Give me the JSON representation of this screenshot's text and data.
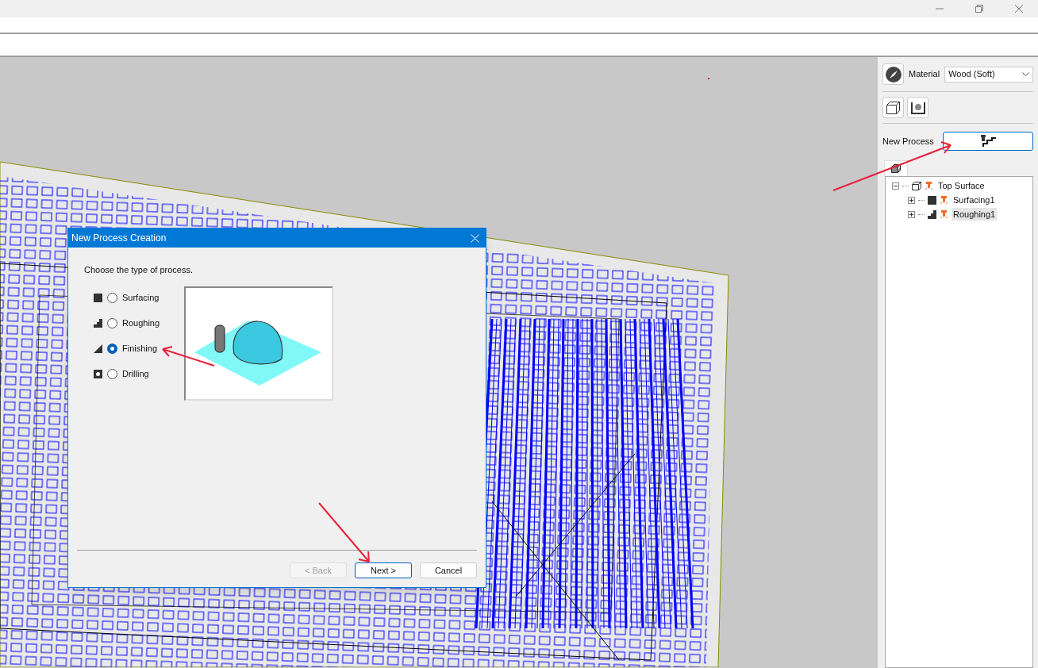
{
  "panel": {
    "material_label": "Material",
    "material_value": "Wood (Soft)",
    "new_process_label": "New Process",
    "tree": [
      {
        "label": "Top Surface",
        "kind": "surface",
        "expanded": true,
        "selected": false,
        "children": [
          {
            "label": "Surfacing1",
            "kind": "surfacing",
            "expanded": false,
            "selected": false
          },
          {
            "label": "Roughing1",
            "kind": "roughing",
            "expanded": false,
            "selected": true
          }
        ]
      }
    ]
  },
  "dialog": {
    "title": "New Process Creation",
    "prompt": "Choose the type of process.",
    "options": [
      {
        "label": "Surfacing",
        "kind": "surfacing",
        "selected": false
      },
      {
        "label": "Roughing",
        "kind": "roughing",
        "selected": false
      },
      {
        "label": "Finishing",
        "kind": "finishing",
        "selected": true
      },
      {
        "label": "Drilling",
        "kind": "drilling",
        "selected": false
      }
    ],
    "buttons": [
      {
        "label": "< Back",
        "disabled": true,
        "default": false
      },
      {
        "label": "Next >",
        "disabled": false,
        "default": true
      },
      {
        "label": "Cancel",
        "disabled": false,
        "default": false
      }
    ]
  }
}
